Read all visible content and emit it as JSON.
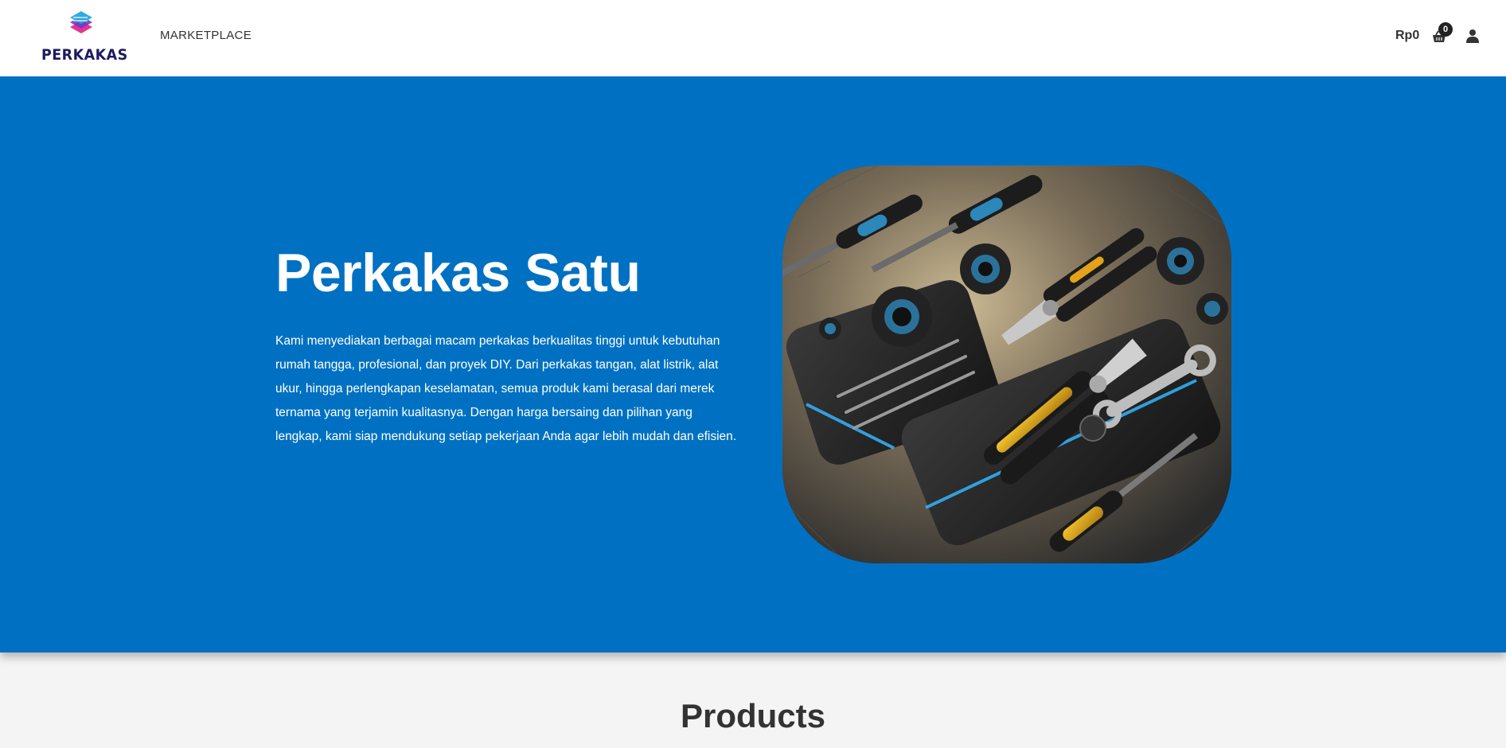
{
  "brand": {
    "name": "PERKAKAS",
    "logo_icon": "layered-logo-icon",
    "colors": {
      "pink": "#e8338f",
      "purple": "#6a3cc7",
      "cyan": "#22a8e0",
      "navy": "#1e1a5e"
    }
  },
  "nav": {
    "marketplace_label": "MARKETPLACE"
  },
  "header_right": {
    "cart_total": "Rp0",
    "cart_count": "0",
    "cart_icon": "shopping-basket-icon",
    "user_icon": "user-icon"
  },
  "hero": {
    "title": "Perkakas Satu",
    "description": "Kami menyediakan berbagai macam perkakas berkualitas tinggi untuk kebutuhan rumah tangga, profesional, dan proyek DIY. Dari perkakas tangan, alat listrik, alat ukur, hingga perlengkapan keselamatan, semua produk kami berasal dari merek ternama yang terjamin kualitasnya. Dengan harga bersaing dan pilihan yang lengkap, kami siap mendukung setiap pekerjaan Anda agar lebih mudah dan efisien.",
    "background": "#0071c2"
  },
  "products": {
    "heading": "Products"
  }
}
